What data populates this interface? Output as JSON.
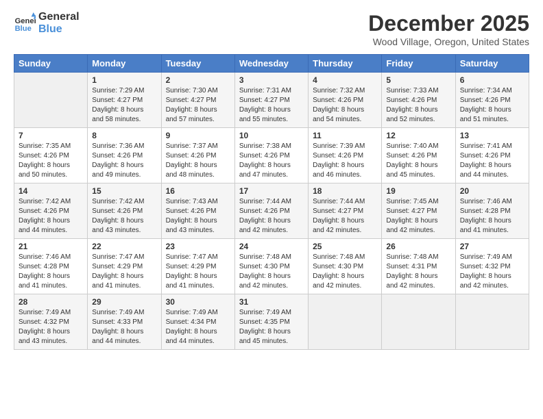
{
  "header": {
    "logo_line1": "General",
    "logo_line2": "Blue",
    "month_title": "December 2025",
    "location": "Wood Village, Oregon, United States"
  },
  "days_of_week": [
    "Sunday",
    "Monday",
    "Tuesday",
    "Wednesday",
    "Thursday",
    "Friday",
    "Saturday"
  ],
  "weeks": [
    [
      {
        "day": "",
        "info": ""
      },
      {
        "day": "1",
        "info": "Sunrise: 7:29 AM\nSunset: 4:27 PM\nDaylight: 8 hours\nand 58 minutes."
      },
      {
        "day": "2",
        "info": "Sunrise: 7:30 AM\nSunset: 4:27 PM\nDaylight: 8 hours\nand 57 minutes."
      },
      {
        "day": "3",
        "info": "Sunrise: 7:31 AM\nSunset: 4:27 PM\nDaylight: 8 hours\nand 55 minutes."
      },
      {
        "day": "4",
        "info": "Sunrise: 7:32 AM\nSunset: 4:26 PM\nDaylight: 8 hours\nand 54 minutes."
      },
      {
        "day": "5",
        "info": "Sunrise: 7:33 AM\nSunset: 4:26 PM\nDaylight: 8 hours\nand 52 minutes."
      },
      {
        "day": "6",
        "info": "Sunrise: 7:34 AM\nSunset: 4:26 PM\nDaylight: 8 hours\nand 51 minutes."
      }
    ],
    [
      {
        "day": "7",
        "info": "Sunrise: 7:35 AM\nSunset: 4:26 PM\nDaylight: 8 hours\nand 50 minutes."
      },
      {
        "day": "8",
        "info": "Sunrise: 7:36 AM\nSunset: 4:26 PM\nDaylight: 8 hours\nand 49 minutes."
      },
      {
        "day": "9",
        "info": "Sunrise: 7:37 AM\nSunset: 4:26 PM\nDaylight: 8 hours\nand 48 minutes."
      },
      {
        "day": "10",
        "info": "Sunrise: 7:38 AM\nSunset: 4:26 PM\nDaylight: 8 hours\nand 47 minutes."
      },
      {
        "day": "11",
        "info": "Sunrise: 7:39 AM\nSunset: 4:26 PM\nDaylight: 8 hours\nand 46 minutes."
      },
      {
        "day": "12",
        "info": "Sunrise: 7:40 AM\nSunset: 4:26 PM\nDaylight: 8 hours\nand 45 minutes."
      },
      {
        "day": "13",
        "info": "Sunrise: 7:41 AM\nSunset: 4:26 PM\nDaylight: 8 hours\nand 44 minutes."
      }
    ],
    [
      {
        "day": "14",
        "info": "Sunrise: 7:42 AM\nSunset: 4:26 PM\nDaylight: 8 hours\nand 44 minutes."
      },
      {
        "day": "15",
        "info": "Sunrise: 7:42 AM\nSunset: 4:26 PM\nDaylight: 8 hours\nand 43 minutes."
      },
      {
        "day": "16",
        "info": "Sunrise: 7:43 AM\nSunset: 4:26 PM\nDaylight: 8 hours\nand 43 minutes."
      },
      {
        "day": "17",
        "info": "Sunrise: 7:44 AM\nSunset: 4:26 PM\nDaylight: 8 hours\nand 42 minutes."
      },
      {
        "day": "18",
        "info": "Sunrise: 7:44 AM\nSunset: 4:27 PM\nDaylight: 8 hours\nand 42 minutes."
      },
      {
        "day": "19",
        "info": "Sunrise: 7:45 AM\nSunset: 4:27 PM\nDaylight: 8 hours\nand 42 minutes."
      },
      {
        "day": "20",
        "info": "Sunrise: 7:46 AM\nSunset: 4:28 PM\nDaylight: 8 hours\nand 41 minutes."
      }
    ],
    [
      {
        "day": "21",
        "info": "Sunrise: 7:46 AM\nSunset: 4:28 PM\nDaylight: 8 hours\nand 41 minutes."
      },
      {
        "day": "22",
        "info": "Sunrise: 7:47 AM\nSunset: 4:29 PM\nDaylight: 8 hours\nand 41 minutes."
      },
      {
        "day": "23",
        "info": "Sunrise: 7:47 AM\nSunset: 4:29 PM\nDaylight: 8 hours\nand 41 minutes."
      },
      {
        "day": "24",
        "info": "Sunrise: 7:48 AM\nSunset: 4:30 PM\nDaylight: 8 hours\nand 42 minutes."
      },
      {
        "day": "25",
        "info": "Sunrise: 7:48 AM\nSunset: 4:30 PM\nDaylight: 8 hours\nand 42 minutes."
      },
      {
        "day": "26",
        "info": "Sunrise: 7:48 AM\nSunset: 4:31 PM\nDaylight: 8 hours\nand 42 minutes."
      },
      {
        "day": "27",
        "info": "Sunrise: 7:49 AM\nSunset: 4:32 PM\nDaylight: 8 hours\nand 42 minutes."
      }
    ],
    [
      {
        "day": "28",
        "info": "Sunrise: 7:49 AM\nSunset: 4:32 PM\nDaylight: 8 hours\nand 43 minutes."
      },
      {
        "day": "29",
        "info": "Sunrise: 7:49 AM\nSunset: 4:33 PM\nDaylight: 8 hours\nand 44 minutes."
      },
      {
        "day": "30",
        "info": "Sunrise: 7:49 AM\nSunset: 4:34 PM\nDaylight: 8 hours\nand 44 minutes."
      },
      {
        "day": "31",
        "info": "Sunrise: 7:49 AM\nSunset: 4:35 PM\nDaylight: 8 hours\nand 45 minutes."
      },
      {
        "day": "",
        "info": ""
      },
      {
        "day": "",
        "info": ""
      },
      {
        "day": "",
        "info": ""
      }
    ]
  ]
}
